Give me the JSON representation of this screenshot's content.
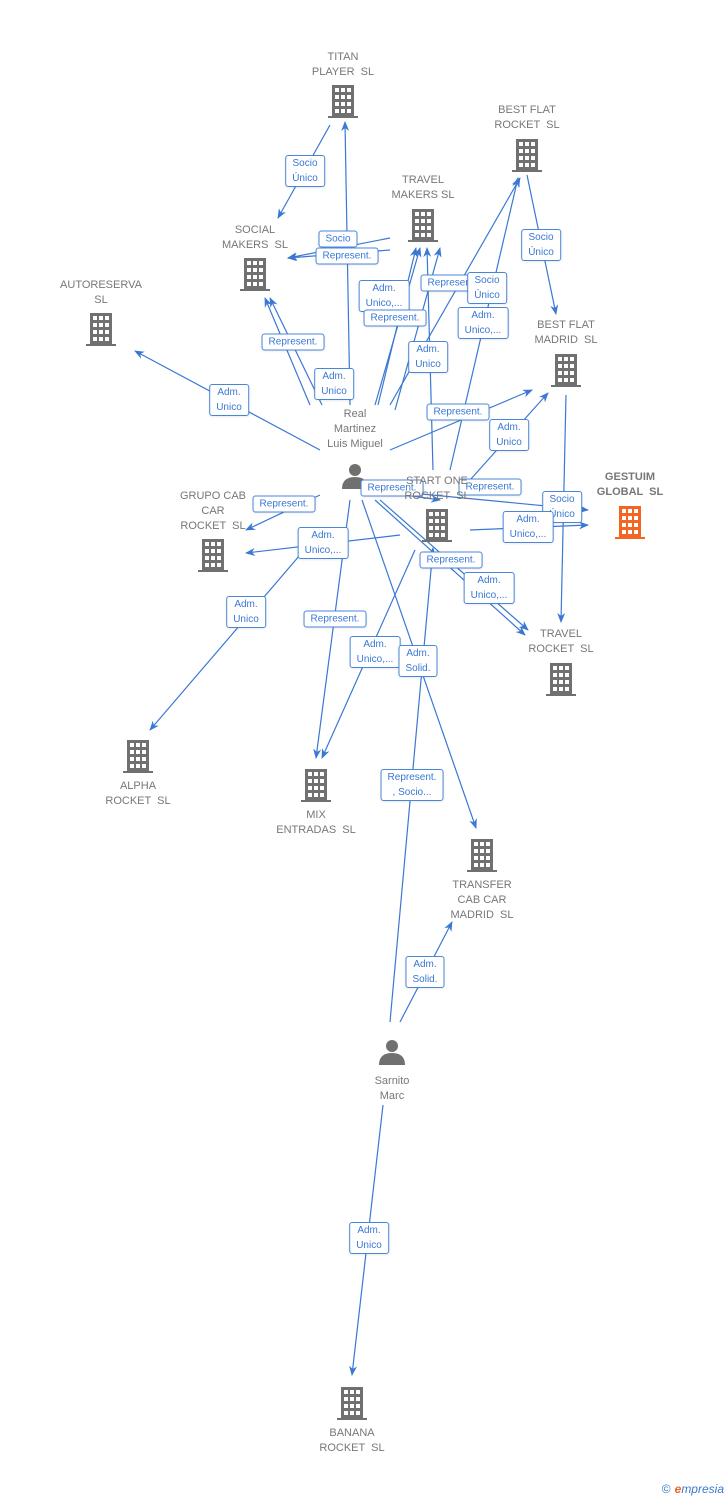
{
  "colors": {
    "edge": "#3a78d4",
    "company": "#707070",
    "highlight": "#f26522",
    "person": "#707070"
  },
  "nodes": [
    {
      "id": "titan",
      "type": "company",
      "label": "TITAN\nPLAYER  SL"
    },
    {
      "id": "bfr",
      "type": "company",
      "label": "BEST FLAT\nROCKET  SL"
    },
    {
      "id": "tm",
      "type": "company",
      "label": "TRAVEL\nMAKERS SL"
    },
    {
      "id": "social",
      "type": "company",
      "label": "SOCIAL\nMAKERS  SL"
    },
    {
      "id": "auto",
      "type": "company",
      "label": "AUTORESERVA\nSL"
    },
    {
      "id": "bfm",
      "type": "company",
      "label": "BEST FLAT\nMADRID  SL"
    },
    {
      "id": "real",
      "type": "person",
      "label": "Real\nMartinez\nLuis Miguel"
    },
    {
      "id": "start",
      "type": "company",
      "label": "START ONE\nROCKET  SL"
    },
    {
      "id": "gestuim",
      "type": "company",
      "main": true,
      "label": "GESTUIM\nGLOBAL  SL"
    },
    {
      "id": "grupo",
      "type": "company",
      "label": "GRUPO CAB\nCAR\nROCKET  SL"
    },
    {
      "id": "tr",
      "type": "company",
      "label": "TRAVEL\nROCKET  SL"
    },
    {
      "id": "alpha",
      "type": "company",
      "label": "ALPHA\nROCKET  SL"
    },
    {
      "id": "mix",
      "type": "company",
      "label": "MIX\nENTRADAS  SL"
    },
    {
      "id": "transfer",
      "type": "company",
      "label": "TRANSFER\nCAB CAR\nMADRID  SL"
    },
    {
      "id": "sarnito",
      "type": "person",
      "label": "Sarnito\nMarc"
    },
    {
      "id": "banana",
      "type": "company",
      "label": "BANANA\nROCKET  SL"
    }
  ],
  "edges": [
    {
      "from": "titan",
      "to": "social",
      "label": "Socio\nÚnico"
    },
    {
      "from": "bfr",
      "to": "bfm",
      "label": "Socio\nÚnico"
    },
    {
      "from": "tm",
      "to": "social",
      "label": "Socio"
    },
    {
      "from": "tm",
      "to": "social",
      "label": "Represent."
    },
    {
      "from": "real",
      "to": "social",
      "label": "Represent."
    },
    {
      "from": "real",
      "to": "social",
      "label": "Adm.\nUnico"
    },
    {
      "from": "real",
      "to": "titan",
      "label": ""
    },
    {
      "from": "real",
      "to": "auto",
      "label": "Adm.\nUnico"
    },
    {
      "from": "real",
      "to": "tm",
      "label": "Adm.\nUnico,..."
    },
    {
      "from": "real",
      "to": "tm",
      "label": "Represent."
    },
    {
      "from": "real",
      "to": "bfr",
      "label": "Represent."
    },
    {
      "from": "real",
      "to": "tm",
      "label": "Socio\nÚnico"
    },
    {
      "from": "start",
      "to": "bfr",
      "label": "Adm.\nUnico,..."
    },
    {
      "from": "start",
      "to": "tm",
      "label": "Adm.\nUnico"
    },
    {
      "from": "real",
      "to": "bfm",
      "label": "Represent."
    },
    {
      "from": "start",
      "to": "bfm",
      "label": "Adm.\nUnico"
    },
    {
      "from": "real",
      "to": "start",
      "label": "Represent."
    },
    {
      "from": "real",
      "to": "gestuim",
      "label": "Represent."
    },
    {
      "from": "bfm",
      "to": "tr",
      "label": "Socio\nÚnico"
    },
    {
      "from": "start",
      "to": "gestuim",
      "label": "Adm.\nUnico,..."
    },
    {
      "from": "real",
      "to": "grupo",
      "label": "Represent."
    },
    {
      "from": "start",
      "to": "grupo",
      "label": "Adm.\nUnico,..."
    },
    {
      "from": "real",
      "to": "alpha",
      "label": "Adm.\nUnico"
    },
    {
      "from": "real",
      "to": "tr",
      "label": "Represent."
    },
    {
      "from": "real",
      "to": "tr",
      "label": "Adm.\nUnico,..."
    },
    {
      "from": "real",
      "to": "mix",
      "label": "Represent."
    },
    {
      "from": "start",
      "to": "mix",
      "label": "Adm.\nUnico,..."
    },
    {
      "from": "real",
      "to": "transfer",
      "label": "Adm.\nSolid."
    },
    {
      "from": "sarnito",
      "to": "start",
      "label": "Represent.\n, Socio..."
    },
    {
      "from": "sarnito",
      "to": "transfer",
      "label": "Adm.\nSolid."
    },
    {
      "from": "sarnito",
      "to": "banana",
      "label": "Adm.\nUnico"
    }
  ],
  "footer": {
    "copyright": "©",
    "brand_e": "e",
    "brand_rest": "mpresia"
  }
}
